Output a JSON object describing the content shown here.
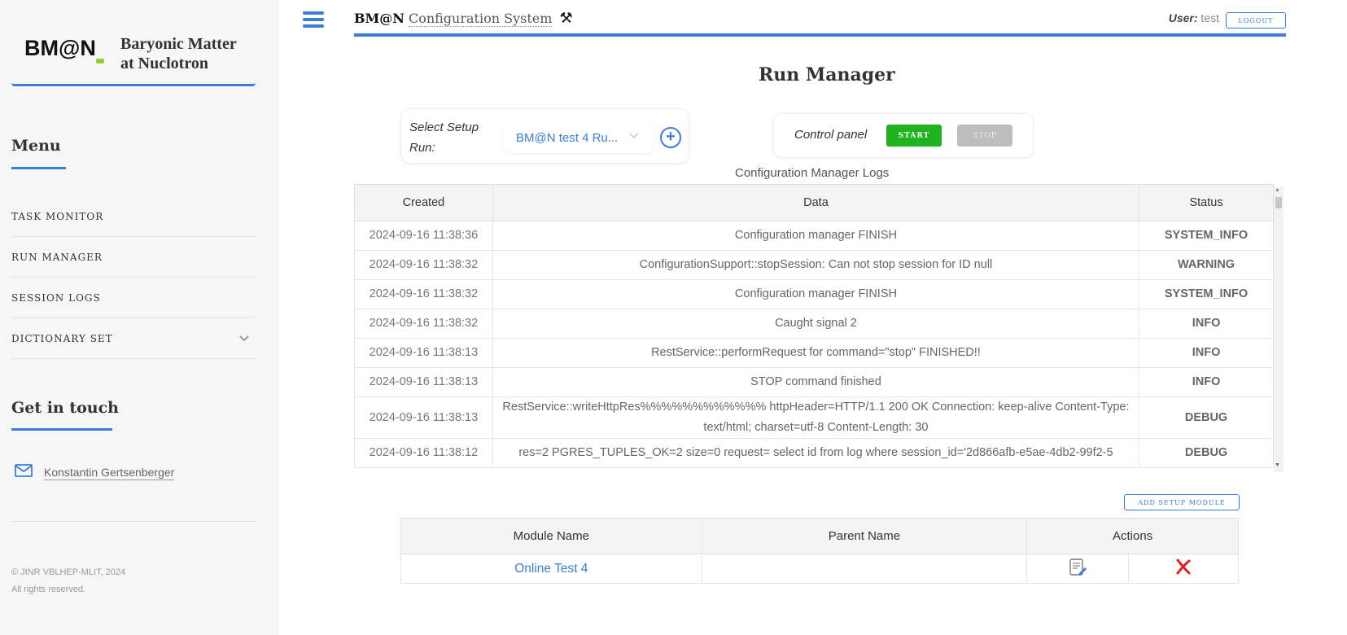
{
  "brand": {
    "logo_text_a": "BM",
    "logo_text_b": "@",
    "logo_text_c": "N",
    "title_line1": "Baryonic Matter",
    "title_line2": "at Nuclotron"
  },
  "sidebar": {
    "menu_heading": "Menu",
    "items": [
      {
        "label": "TASK MONITOR"
      },
      {
        "label": "RUN MANAGER"
      },
      {
        "label": "SESSION LOGS"
      },
      {
        "label": "DICTIONARY SET",
        "icon": "chevron-down-icon"
      }
    ],
    "touch_heading": "Get in touch",
    "contact_name": "Konstantin Gertsenberger",
    "copyright_line1": "© JINR VBLHEP-MLIT, 2024",
    "copyright_line2": "All rights reserved."
  },
  "header": {
    "system_bold": "BM@N",
    "system_rest": "Configuration System",
    "user_label": "User:",
    "user_name": "test",
    "logout_label": "LOGOUT"
  },
  "main": {
    "page_title": "Run Manager",
    "setup": {
      "label": "Select Setup Run:",
      "selected": "BM@N test 4 Ru..."
    },
    "control": {
      "label": "Control panel",
      "start_label": "START",
      "stop_label": "STOP"
    },
    "logs_title": "Configuration Manager Logs",
    "logs_columns": [
      "Created",
      "Data",
      "Status"
    ],
    "logs": [
      {
        "created": "2024-09-16 11:38:36",
        "data": "Configuration manager FINISH",
        "status": "SYSTEM_INFO",
        "cls": "st-sys"
      },
      {
        "created": "2024-09-16 11:38:32",
        "data": "ConfigurationSupport::stopSession: Can not stop session for ID null",
        "status": "WARNING",
        "cls": "st-warn"
      },
      {
        "created": "2024-09-16 11:38:32",
        "data": "Configuration manager FINISH",
        "status": "SYSTEM_INFO",
        "cls": "st-sys"
      },
      {
        "created": "2024-09-16 11:38:32",
        "data": "Caught signal 2",
        "status": "INFO",
        "cls": "st-info"
      },
      {
        "created": "2024-09-16 11:38:13",
        "data": "RestService::performRequest for command=\"stop\" FINISHED!!",
        "status": "INFO",
        "cls": "st-info"
      },
      {
        "created": "2024-09-16 11:38:13",
        "data": "STOP command finished",
        "status": "INFO",
        "cls": "st-info"
      },
      {
        "created": "2024-09-16 11:38:13",
        "data": "RestService::writeHttpRes%%%%%%%%%%%% httpHeader=HTTP/1.1 200 OK Connection: keep-alive Content-Type: text/html; charset=utf-8 Content-Length: 30",
        "status": "DEBUG",
        "cls": "st-debug"
      },
      {
        "created": "2024-09-16 11:38:12",
        "data": "res=2 PGRES_TUPLES_OK=2 size=0 request= select id from log where session_id='2d866afb-e5ae-4db2-99f2-5",
        "status": "DEBUG",
        "cls": "st-debug"
      }
    ],
    "add_module_label": "ADD SETUP MODULE",
    "module_columns": [
      "Module Name",
      "Parent Name",
      "Actions"
    ],
    "modules": [
      {
        "name": "Online Test 4",
        "parent": ""
      }
    ]
  },
  "colors": {
    "accent": "#3b7dd8",
    "start": "#1fb31f",
    "info": "#22bb22",
    "warning": "#e8d020",
    "delete": "#e02020"
  }
}
